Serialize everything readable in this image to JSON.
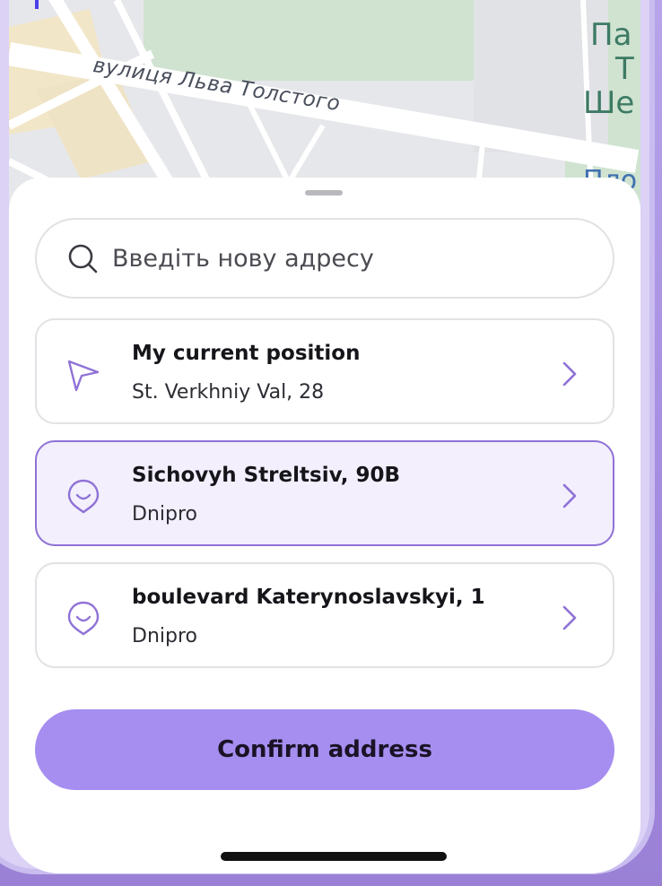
{
  "map": {
    "street_label": "вулиця Льва Толстого",
    "park_label_lines": [
      "Па",
      "Т",
      "Ше"
    ],
    "place_label": "Пло"
  },
  "search": {
    "placeholder": "Введіть нову адресу",
    "icon": "search-icon"
  },
  "locations": [
    {
      "title": "My current position",
      "subtitle": "St. Verkhniy Val, 28",
      "icon": "navigation-arrow-icon",
      "selected": false
    },
    {
      "title": "Sichovyh Streltsiv, 90B",
      "subtitle": "Dnipro",
      "icon": "location-pin-icon",
      "selected": true
    },
    {
      "title": "boulevard Katerynoslavskyi, 1",
      "subtitle": "Dnipro",
      "icon": "location-pin-icon",
      "selected": false
    }
  ],
  "confirm_label": "Confirm address",
  "colors": {
    "accent": "#8f72d6",
    "button": "#a68ef0",
    "selected_bg": "#f3effd",
    "pin": "#4b3ee8"
  }
}
